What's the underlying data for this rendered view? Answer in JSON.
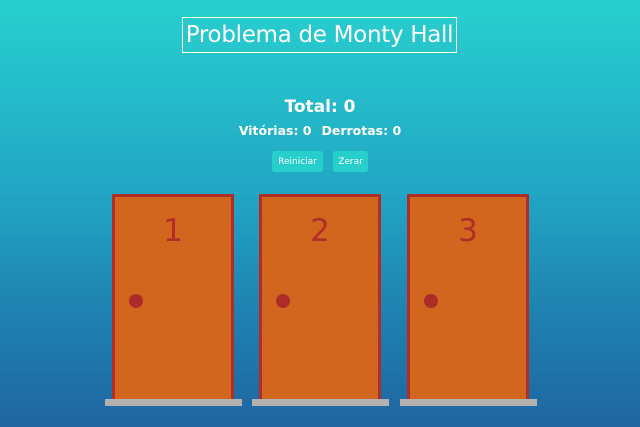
{
  "title": "Problema de Monty Hall",
  "score": {
    "total_label": "Total: 0",
    "wins_label": "Vitórias: 0",
    "losses_label": "Derrotas: 0"
  },
  "buttons": {
    "restart_label": "Reiniciar",
    "reset_label": "Zerar"
  },
  "doors": [
    {
      "number": "1"
    },
    {
      "number": "2"
    },
    {
      "number": "3"
    }
  ],
  "colors": {
    "background_top": "#27d0cf",
    "background_bottom": "#1f66a2",
    "door_fill": "#d2661f",
    "door_border": "#b02e28",
    "knob": "#ad2c2a",
    "button": "#27cfcc",
    "sill": "#b4b2ae"
  }
}
